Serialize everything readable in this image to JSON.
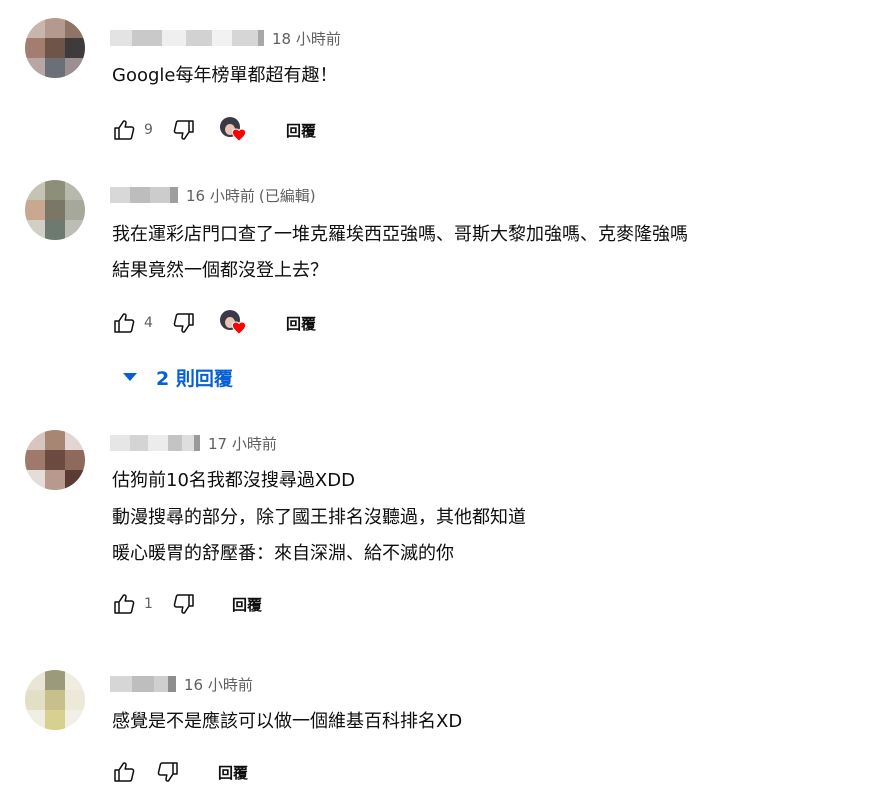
{
  "comments": [
    {
      "time": "18 小時前",
      "edited": "",
      "lines": [
        "Google每年榜單都超有趣！"
      ],
      "likes": "9",
      "creator_heart": true,
      "reply_label": "回覆"
    },
    {
      "time": "16 小時前",
      "edited": "(已編輯)",
      "lines": [
        "我在運彩店門口查了一堆克羅埃西亞強嗎、哥斯大黎加強嗎、克麥隆強嗎",
        "結果竟然一個都沒登上去？"
      ],
      "likes": "4",
      "creator_heart": true,
      "reply_label": "回覆",
      "replies_toggle": "2 則回覆"
    },
    {
      "time": "17 小時前",
      "edited": "",
      "lines": [
        "估狗前10名我都沒搜尋過XDD",
        "動漫搜尋的部分，除了國王排名沒聽過，其他都知道",
        "暖心暖胃的舒壓番：來自深淵、給不滅的你"
      ],
      "likes": "1",
      "creator_heart": false,
      "reply_label": "回覆"
    },
    {
      "time": "16 小時前",
      "edited": "",
      "lines": [
        "感覺是不是應該可以做一個維基百科排名XD"
      ],
      "likes": "",
      "creator_heart": false,
      "reply_label": "回覆"
    }
  ],
  "icons": {
    "like": "thumbs-up-icon",
    "dislike": "thumbs-down-icon",
    "heart": "creator-heart-icon",
    "caret": "caret-down-icon"
  },
  "colors": {
    "text": "#0f0f0f",
    "meta": "#606060",
    "link": "#065fd4",
    "heart": "#ff0000"
  }
}
